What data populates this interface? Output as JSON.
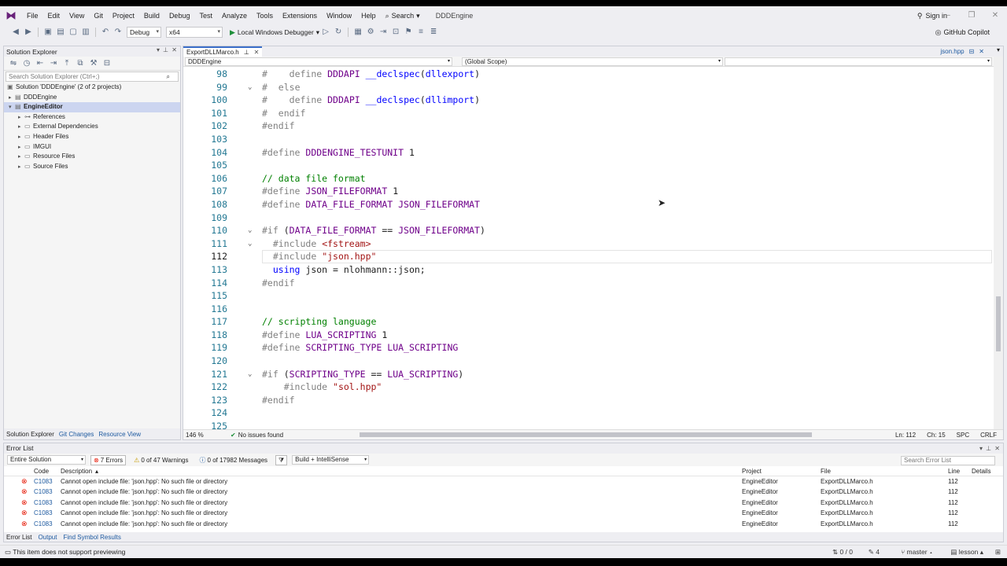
{
  "menu": {
    "items": [
      "File",
      "Edit",
      "View",
      "Git",
      "Project",
      "Build",
      "Debug",
      "Test",
      "Analyze",
      "Tools",
      "Extensions",
      "Window",
      "Help"
    ],
    "search_label": "Search",
    "app_name": "DDDEngine",
    "sign_in": "Sign in"
  },
  "toolbar": {
    "config": "Debug",
    "platform": "x64",
    "run_label": "Local Windows Debugger",
    "copilot": "GitHub Copilot"
  },
  "solution_explorer": {
    "title": "Solution Explorer",
    "search_placeholder": "Search Solution Explorer (Ctrl+;)",
    "solution": "Solution 'DDDEngine' (2 of 2 projects)",
    "projects": [
      {
        "name": "DDDEngine",
        "expanded": false,
        "selected": false
      },
      {
        "name": "EngineEditor",
        "expanded": true,
        "selected": true
      }
    ],
    "children": [
      "References",
      "External Dependencies",
      "Header Files",
      "IMGUI",
      "Resource Files",
      "Source Files"
    ],
    "tabs": [
      "Solution Explorer",
      "Git Changes",
      "Resource View"
    ]
  },
  "editor": {
    "tab": "ExportDLLMarco.h",
    "preview_tab": "json.hpp",
    "nav_project": "DDDEngine",
    "nav_scope": "(Global Scope)",
    "zoom": "146 %",
    "issues": "No issues found",
    "position": {
      "ln": "Ln: 112",
      "ch": "Ch: 15",
      "ins": "SPC",
      "eol": "CRLF"
    },
    "current_line": 112,
    "lines": [
      {
        "n": "98",
        "fold": "",
        "html": "<span class='pp'>#</span>    <span class='pp'>define</span> <span class='mc'>DDDAPI</span> <span class='kw'>__declspec</span>(<span class='kw'>dllexport</span>)"
      },
      {
        "n": "99",
        "fold": "⌄",
        "html": "<span class='pp'>#</span>  <span class='pp'>else</span>"
      },
      {
        "n": "100",
        "fold": "",
        "html": "<span class='pp'>#</span>    <span class='pp'>define</span> <span class='mc'>DDDAPI</span> <span class='kw'>__declspec</span>(<span class='kw'>dllimport</span>)"
      },
      {
        "n": "101",
        "fold": "",
        "html": "<span class='pp'>#</span>  <span class='pp'>endif</span>"
      },
      {
        "n": "102",
        "fold": "",
        "html": "<span class='pp'>#endif</span>"
      },
      {
        "n": "103",
        "fold": "",
        "html": ""
      },
      {
        "n": "104",
        "fold": "",
        "html": "<span class='pp'>#define</span> <span class='mc'>DDDENGINE_TESTUNIT</span> 1"
      },
      {
        "n": "105",
        "fold": "",
        "html": ""
      },
      {
        "n": "106",
        "fold": "",
        "html": "<span class='cm'>// data file format</span>"
      },
      {
        "n": "107",
        "fold": "",
        "html": "<span class='pp'>#define</span> <span class='mc'>JSON_FILEFORMAT</span> 1"
      },
      {
        "n": "108",
        "fold": "",
        "html": "<span class='pp'>#define</span> <span class='mc'>DATA_FILE_FORMAT</span> <span class='mc'>JSON_FILEFORMAT</span>"
      },
      {
        "n": "109",
        "fold": "",
        "html": ""
      },
      {
        "n": "110",
        "fold": "⌄",
        "html": "<span class='pp'>#if</span> (<span class='mc'>DATA_FILE_FORMAT</span> == <span class='mc'>JSON_FILEFORMAT</span>)"
      },
      {
        "n": "111",
        "fold": "⌄",
        "html": "  <span class='pp'>#include</span> <span class='st'>&lt;fstream&gt;</span>"
      },
      {
        "n": "112",
        "fold": "",
        "html": "  <span class='pp'>#include</span> <span class='st'>\"json.hpp\"</span>"
      },
      {
        "n": "113",
        "fold": "",
        "html": "  <span class='kw'>using</span> json = nlohmann::json;"
      },
      {
        "n": "114",
        "fold": "",
        "html": "<span class='pp'>#endif</span>"
      },
      {
        "n": "115",
        "fold": "",
        "html": ""
      },
      {
        "n": "116",
        "fold": "",
        "html": ""
      },
      {
        "n": "117",
        "fold": "",
        "html": "<span class='cm'>// scripting language</span>"
      },
      {
        "n": "118",
        "fold": "",
        "html": "<span class='pp'>#define</span> <span class='mc'>LUA_SCRIPTING</span> 1"
      },
      {
        "n": "119",
        "fold": "",
        "html": "<span class='pp'>#define</span> <span class='mc'>SCRIPTING_TYPE</span> <span class='mc'>LUA_SCRIPTING</span>"
      },
      {
        "n": "120",
        "fold": "",
        "html": ""
      },
      {
        "n": "121",
        "fold": "⌄",
        "html": "<span class='pp'>#if</span> (<span class='mc'>SCRIPTING_TYPE</span> == <span class='mc'>LUA_SCRIPTING</span>)"
      },
      {
        "n": "122",
        "fold": "",
        "html": "    <span class='pp'>#include</span> <span class='st'>\"sol.hpp\"</span>"
      },
      {
        "n": "123",
        "fold": "",
        "html": "<span class='pp'>#endif</span>"
      },
      {
        "n": "124",
        "fold": "",
        "html": ""
      },
      {
        "n": "125",
        "fold": "",
        "html": ""
      }
    ]
  },
  "error_list": {
    "title": "Error List",
    "scope": "Entire Solution",
    "errors": "7 Errors",
    "warnings": "0 of 47 Warnings",
    "messages": "0 of 17982 Messages",
    "build_filter": "Build + IntelliSense",
    "search_placeholder": "Search Error List",
    "columns": [
      "Code",
      "Description",
      "Project",
      "File",
      "Line",
      "Details"
    ],
    "rows": [
      {
        "code": "C1083",
        "desc": "Cannot open include file: 'json.hpp': No such file or directory",
        "project": "EngineEditor",
        "file": "ExportDLLMarco.h",
        "line": "112"
      },
      {
        "code": "C1083",
        "desc": "Cannot open include file: 'json.hpp': No such file or directory",
        "project": "EngineEditor",
        "file": "ExportDLLMarco.h",
        "line": "112"
      },
      {
        "code": "C1083",
        "desc": "Cannot open include file: 'json.hpp': No such file or directory",
        "project": "EngineEditor",
        "file": "ExportDLLMarco.h",
        "line": "112"
      },
      {
        "code": "C1083",
        "desc": "Cannot open include file: 'json.hpp': No such file or directory",
        "project": "EngineEditor",
        "file": "ExportDLLMarco.h",
        "line": "112"
      },
      {
        "code": "C1083",
        "desc": "Cannot open include file: 'json.hpp': No such file or directory",
        "project": "EngineEditor",
        "file": "ExportDLLMarco.h",
        "line": "112"
      }
    ],
    "tabs": [
      "Error List",
      "Output",
      "Find Symbol Results"
    ]
  },
  "status_bar": {
    "message": "This item does not support previewing",
    "sync": "0 / 0",
    "edits": "4",
    "branch": "master",
    "repo": "lesson"
  },
  "colors": {
    "accent": "#3c6fc9",
    "error": "#e51400",
    "keyword": "#0000ff",
    "macro": "#6f008a",
    "string": "#a31515",
    "comment": "#008000"
  }
}
